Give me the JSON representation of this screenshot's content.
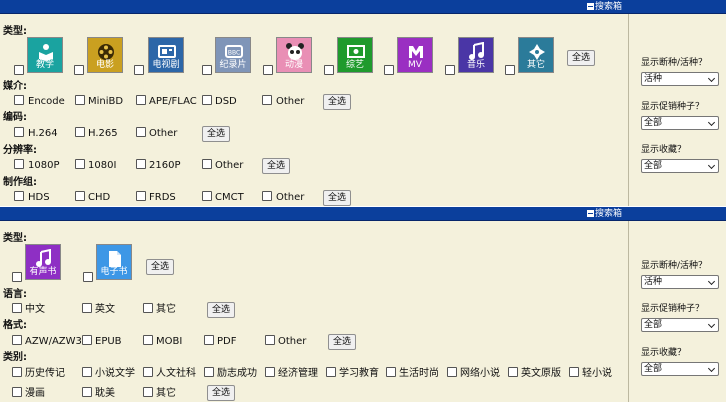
{
  "toggle_label": "搜索箱",
  "select_all": "全选",
  "side": {
    "q1": "显示断种/活种？",
    "q1_value": "活种",
    "q2": "显示促销种子？",
    "q2_value": "全部",
    "q3": "显示收藏？",
    "q3_value": "全部"
  },
  "top": {
    "type_label": "类型:",
    "types": [
      "教学",
      "电影",
      "电视剧",
      "纪录片",
      "动漫",
      "综艺",
      "MV",
      "音乐",
      "其它"
    ],
    "media_label": "媒介:",
    "media": [
      "Encode",
      "MiniBD",
      "APE/FLAC",
      "DSD",
      "Other"
    ],
    "codec_label": "编码:",
    "codec": [
      "H.264",
      "H.265",
      "Other"
    ],
    "res_label": "分辨率:",
    "res": [
      "1080P",
      "1080I",
      "2160P",
      "Other"
    ],
    "group_label": "制作组:",
    "group": [
      "HDS",
      "CHD",
      "FRDS",
      "CMCT",
      "Other"
    ]
  },
  "bottom": {
    "type_label": "类型:",
    "types": [
      "有声书",
      "电子书"
    ],
    "lang_label": "语言:",
    "lang": [
      "中文",
      "英文",
      "其它"
    ],
    "format_label": "格式:",
    "format": [
      "AZW/AZW3",
      "EPUB",
      "MOBI",
      "PDF",
      "Other"
    ],
    "cat_label": "类别:",
    "cat1": [
      "历史传记",
      "小说文学",
      "人文社科",
      "励志成功",
      "经济管理",
      "学习教育",
      "生活时尚",
      "网络小说",
      "英文原版",
      "轻小说"
    ],
    "cat2": [
      "漫画",
      "耽美",
      "其它"
    ]
  },
  "colors": {
    "bar": "#0b3f9c",
    "panel": "#f4f1dc",
    "tiles": [
      "#1aa3a0",
      "#caa020",
      "#2c66a8",
      "#7f95b8",
      "#e98fb5",
      "#1f9a2c",
      "#9a2fc2",
      "#4a36a6",
      "#2b7b9a"
    ],
    "book_tiles": [
      "#8e2fc4",
      "#3d97e6"
    ]
  }
}
